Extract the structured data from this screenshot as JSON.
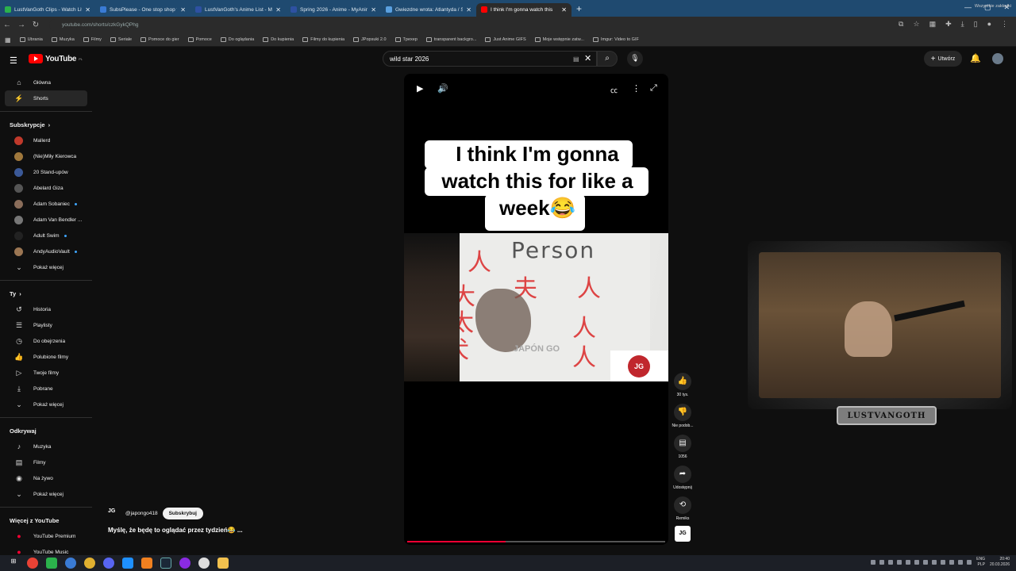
{
  "browser": {
    "tabs": [
      {
        "title": "LustVanGoth Clips - Watch Live",
        "color": "#2bb24c",
        "active": false
      },
      {
        "title": "SubsPlease - One stop shop fo",
        "color": "#3a7bd5",
        "active": false
      },
      {
        "title": "LustVanGoth's Anime List - My",
        "color": "#2e51a2",
        "active": false
      },
      {
        "title": "Spring 2026 - Anime - MyAnim",
        "color": "#2e51a2",
        "active": false
      },
      {
        "title": "Gwiezdne wrota: Atlantyda / St",
        "color": "#5aa0e0",
        "active": false
      },
      {
        "title": "I think I'm gonna watch this",
        "color": "#ff0000",
        "active": true
      }
    ],
    "url": "youtube.com/shorts/czkGykQPhg",
    "bookmarks": [
      "Ubrania",
      "Muzyka",
      "Filmy",
      "Seriale",
      "Pomoce do gier",
      "Pomoce",
      "Do oglądania",
      "Do kupienia",
      "Filmy do kupienia",
      "JPopsuki 2.0",
      "Tpexep",
      "transparent backgro...",
      "Just Anime GIFS",
      "Moje wstępnie zatw...",
      "Imgur: Video to GIF"
    ],
    "bookmarks_all": "Wszystkie zakładki"
  },
  "header": {
    "logo": "YouTube",
    "region": "PL",
    "search_value": "wild star 2026",
    "create_label": "Utwórz"
  },
  "sidebar": {
    "main": [
      {
        "label": "Główna",
        "icon": "home-icon",
        "glyph": "⌂"
      },
      {
        "label": "Shorts",
        "icon": "shorts-icon",
        "glyph": "⚡"
      }
    ],
    "subs_title": "Subskrypcje",
    "subs": [
      {
        "label": "Mallerd",
        "color": "#c0392b",
        "dot": false
      },
      {
        "label": "(Nie)Miły Kierowca",
        "color": "#a0783c",
        "dot": false
      },
      {
        "label": "20 Stand-upów",
        "color": "#3b5998",
        "dot": false
      },
      {
        "label": "Abelard Giza",
        "color": "#555",
        "dot": false
      },
      {
        "label": "Adam Sobaniec",
        "color": "#8a6d5a",
        "dot": true
      },
      {
        "label": "Adam Van Bendler ...",
        "color": "#777",
        "dot": false
      },
      {
        "label": "Adult Swim",
        "color": "#222",
        "dot": true
      },
      {
        "label": "AndyAudioVault",
        "color": "#9b7653",
        "dot": true
      }
    ],
    "more": "Pokaż więcej",
    "you_title": "Ty",
    "you": [
      {
        "label": "Historia",
        "glyph": "↺"
      },
      {
        "label": "Playlisty",
        "glyph": "☰"
      },
      {
        "label": "Do obejrzenia",
        "glyph": "◷"
      },
      {
        "label": "Polubione filmy",
        "glyph": "👍"
      },
      {
        "label": "Twoje filmy",
        "glyph": "▷"
      },
      {
        "label": "Pobrane",
        "glyph": "⤓"
      }
    ],
    "explore_title": "Odkrywaj",
    "explore": [
      {
        "label": "Muzyka",
        "glyph": "♪"
      },
      {
        "label": "Filmy",
        "glyph": "▤"
      },
      {
        "label": "Na żywo",
        "glyph": "◉"
      }
    ],
    "more_yt_title": "Więcej z YouTube",
    "more_yt": [
      {
        "label": "YouTube Premium"
      },
      {
        "label": "YouTube Music"
      }
    ]
  },
  "short": {
    "caption_lines": [
      "I think I'm gonna",
      "watch this for like a",
      "week😂"
    ],
    "board_text": "Person",
    "watermark": "JAPÓN GO",
    "channel_logo_text": "JG",
    "progress": 0.38
  },
  "actions": {
    "likes": "30 tys.",
    "dislike": "Nie podob...",
    "comments": "1056",
    "share": "Udostępnij",
    "remix": "Remiks"
  },
  "channel": {
    "handle": "@japongo418",
    "subscribe": "Subskrybuj",
    "icon_text": "JG"
  },
  "video_title": "Myślę, że będę to oglądać przez tydzień😂 ...",
  "stream": {
    "name": "LUSTVANGOTH"
  },
  "taskbar": {
    "lang_top": "ENG",
    "lang_bottom": "PLP",
    "time": "20:40",
    "date": "20.03.2026"
  }
}
